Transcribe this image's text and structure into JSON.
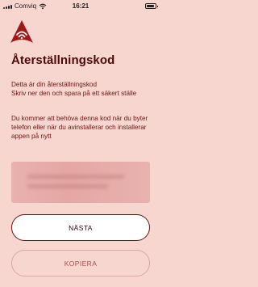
{
  "status_bar": {
    "carrier": "Comviq",
    "time": "16:21",
    "icons": [
      "signal-icon",
      "wifi-icon",
      "battery-icon"
    ]
  },
  "logo": {
    "icon": "app-logo-icon",
    "color": "#a11818"
  },
  "title": "Återställningskod",
  "intro": {
    "line1": "Detta är din återställningskod",
    "line2": "Skriv ner den och spara på ett säkert ställe"
  },
  "info": "Du kommer att behöva denna kod när du byter telefon eller när du avinstallerar och installerar appen på nytt",
  "buttons": {
    "next": "NÄSTA",
    "copy": "KOPIERA"
  },
  "colors": {
    "background": "#f7d6cf",
    "title": "#4d0a0a",
    "accent": "#a11818"
  }
}
